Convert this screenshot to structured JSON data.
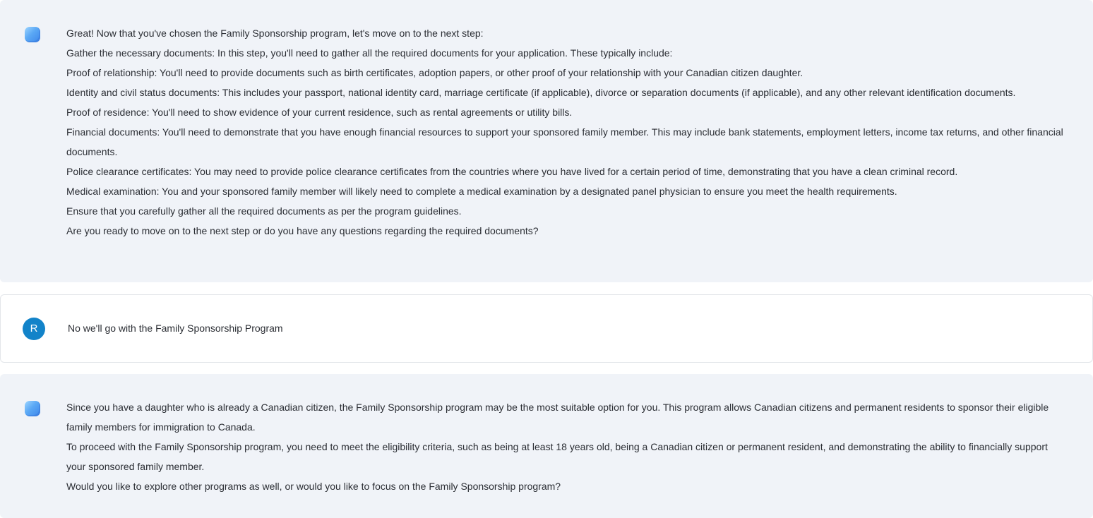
{
  "messages": [
    {
      "role": "assistant",
      "avatar_icon": "assistant-logo-icon",
      "paragraphs": [
        "Great! Now that you've chosen the Family Sponsorship program, let's move on to the next step:",
        "Gather the necessary documents: In this step, you'll need to gather all the required documents for your application. These typically include:",
        "Proof of relationship: You'll need to provide documents such as birth certificates, adoption papers, or other proof of your relationship with your Canadian citizen daughter.",
        "Identity and civil status documents: This includes your passport, national identity card, marriage certificate (if applicable), divorce or separation documents (if applicable), and any other relevant identification documents.",
        "Proof of residence: You'll need to show evidence of your current residence, such as rental agreements or utility bills.",
        "Financial documents: You'll need to demonstrate that you have enough financial resources to support your sponsored family member. This may include bank statements, employment letters, income tax returns, and other financial documents.",
        "Police clearance certificates: You may need to provide police clearance certificates from the countries where you have lived for a certain period of time, demonstrating that you have a clean criminal record.",
        "Medical examination: You and your sponsored family member will likely need to complete a medical examination by a designated panel physician to ensure you meet the health requirements.",
        "Ensure that you carefully gather all the required documents as per the program guidelines.",
        "Are you ready to move on to the next step or do you have any questions regarding the required documents?"
      ]
    },
    {
      "role": "user",
      "avatar_letter": "R",
      "avatar_color": "#1283c9",
      "paragraphs": [
        "No we'll go with the Family Sponsorship Program"
      ]
    },
    {
      "role": "assistant",
      "avatar_icon": "assistant-logo-icon",
      "paragraphs": [
        "Since you have a daughter who is already a Canadian citizen, the Family Sponsorship program may be the most suitable option for you. This program allows Canadian citizens and permanent residents to sponsor their eligible family members for immigration to Canada.",
        "To proceed with the Family Sponsorship program, you need to meet the eligibility criteria, such as being at least 18 years old, being a Canadian citizen or permanent resident, and demonstrating the ability to financially support your sponsored family member.",
        "Would you like to explore other programs as well, or would you like to focus on the Family Sponsorship program?"
      ]
    }
  ],
  "colors": {
    "assistant_bg": "#f0f3f8",
    "user_bg": "#ffffff",
    "text": "#2a2d33"
  }
}
